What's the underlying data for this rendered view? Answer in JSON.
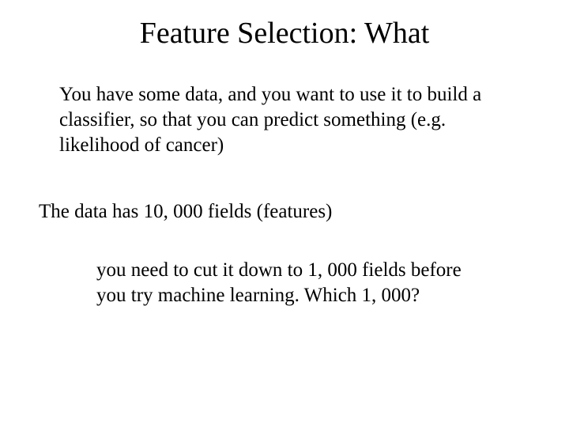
{
  "slide": {
    "title": "Feature Selection:  What",
    "para1": "You have some data, and you want to use it to build a classifier, so that you can predict something  (e.g. likelihood of cancer)",
    "para2": "The data has 10, 000 fields (features)",
    "para3": "you need to cut it down to 1, 000 fields before you try machine learning. Which 1, 000?"
  }
}
